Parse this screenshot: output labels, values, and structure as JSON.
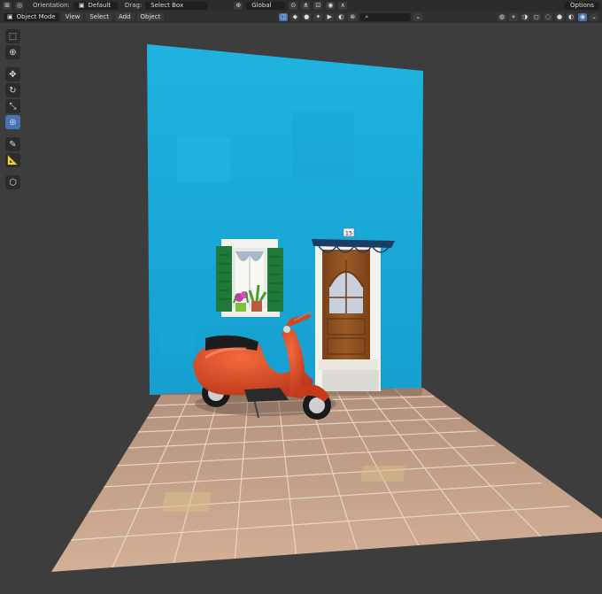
{
  "header": {
    "orientation_label": "Orientation:",
    "orientation_value": "Default",
    "drag_label": "Drag:",
    "drag_value": "Select Box",
    "transform_space": "Global",
    "options_label": "Options"
  },
  "viewport_header": {
    "mode": "Object Mode",
    "menus": [
      "View",
      "Select",
      "Add",
      "Object"
    ]
  },
  "scene": {
    "house_number": "15",
    "colors": {
      "wall": "#1fb0dc",
      "shutter": "#1f7a3a",
      "door": "#8f5222",
      "scooter": "#d84420",
      "floor": "#c9a58b",
      "background": "#3d3d3d"
    }
  }
}
